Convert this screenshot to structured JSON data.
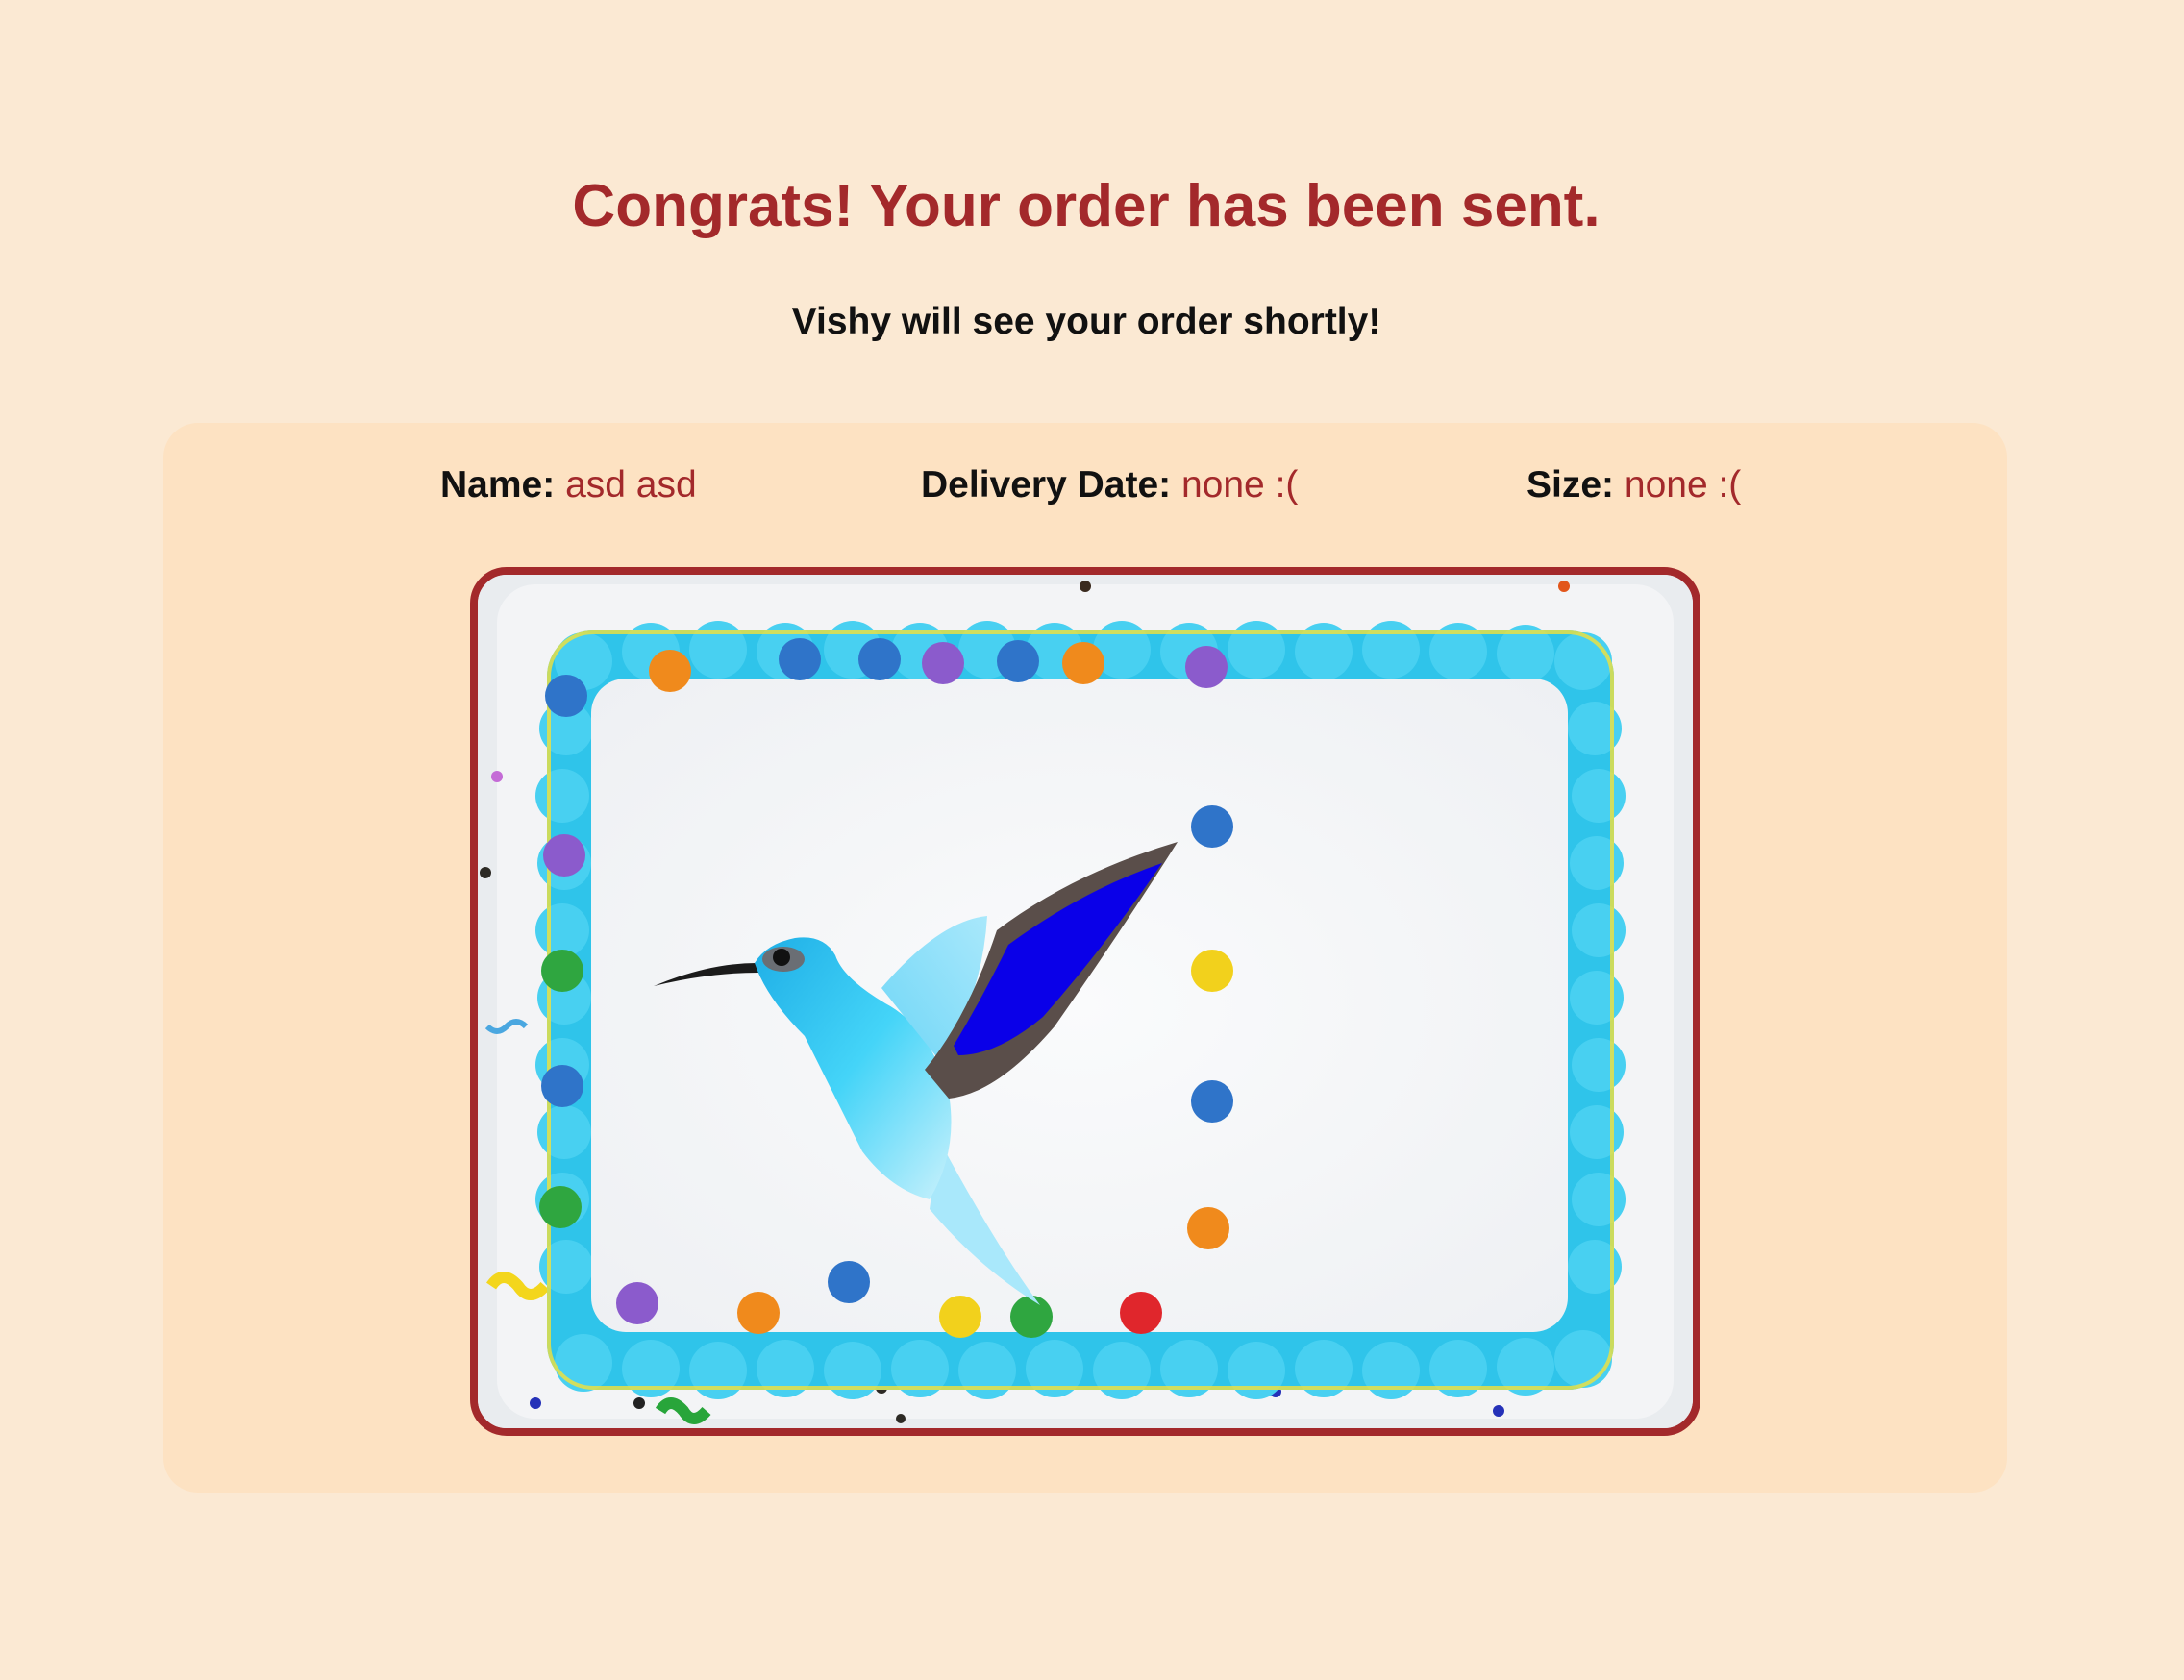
{
  "header": {
    "title": "Congrats! Your order has been sent.",
    "subtitle": "Vishy will see your order shortly!"
  },
  "order": {
    "name_label": "Name:",
    "name_value": "asd asd",
    "date_label": "Delivery Date:",
    "date_value": "none :(",
    "size_label": "Size:",
    "size_value": "none :("
  },
  "cake_preview": {
    "icon": "hummingbird-icon",
    "frosting_color": "#2fc4ea",
    "border_color": "#a3292b"
  },
  "colors": {
    "background": "#fbe9d3",
    "card": "#fde2c2",
    "accent": "#a3292b"
  }
}
